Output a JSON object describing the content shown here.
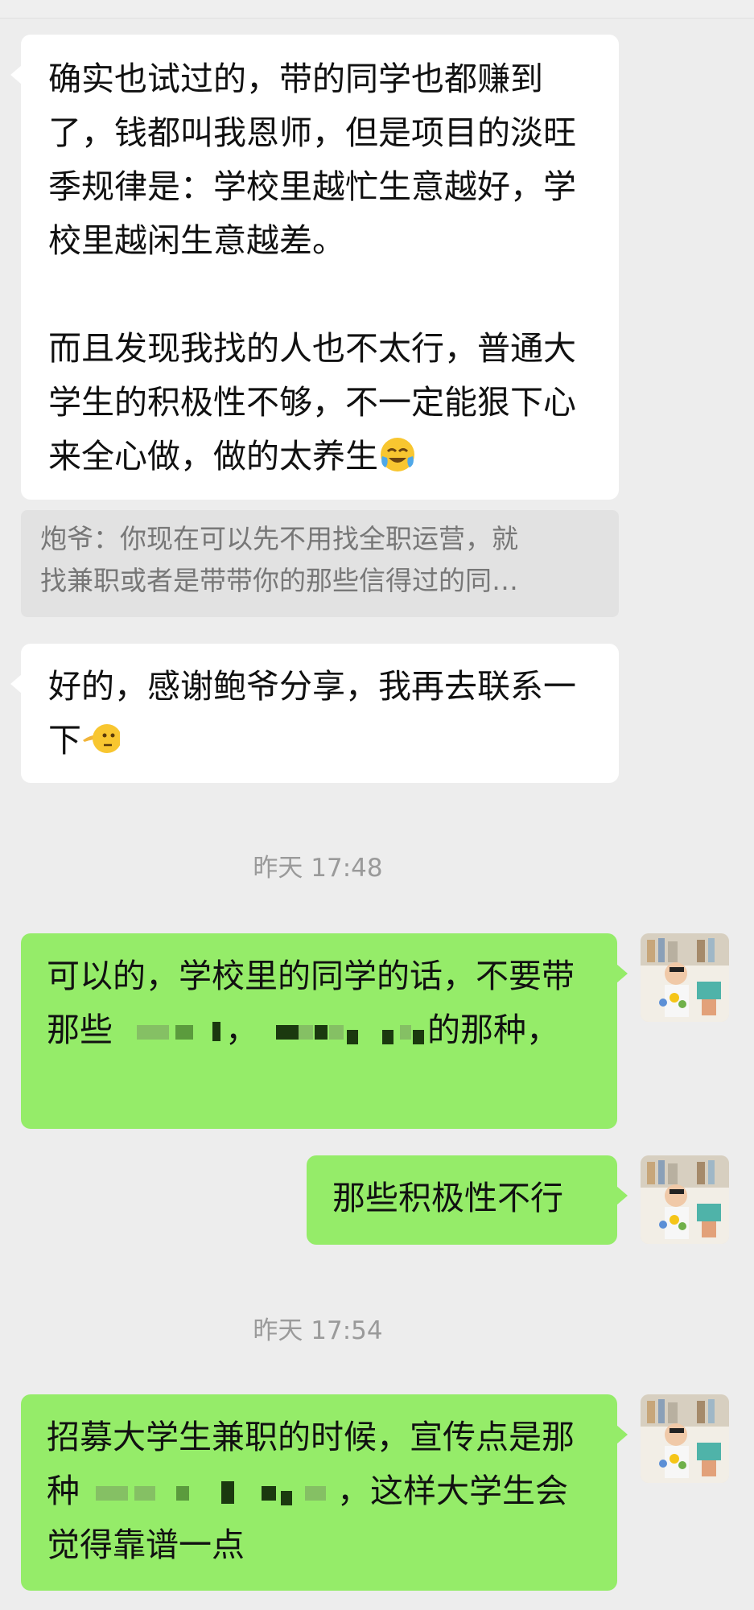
{
  "messages": [
    {
      "side": "left",
      "paragraph1": "确实也试过的，带的同学也都赚到了，钱都叫我恩师，但是项目的淡旺季规律是：学校里越忙生意越好，学校里越闲生意越差。",
      "paragraph2": "而且发现我找的人也不太行，普通大学生的积极性不够，不一定能狠下心来全心做，做的太养生",
      "emoji": "face-with-tears-of-joy-emoji"
    },
    {
      "quote_line1": "炮爷：你现在可以先不用找全职运营，就",
      "quote_line2": "找兼职或者是带带你的那些信得过的同…"
    },
    {
      "side": "left",
      "text": "好的，感谢鲍爷分享，我再去联系一下",
      "emoji": "pointing-face-emoji"
    },
    {
      "timestamp": "昨天 17:48"
    },
    {
      "side": "right",
      "part1": "可以的，学校里的同学的话，不要带那些",
      "part2": "，",
      "part3": "的那种，"
    },
    {
      "side": "right",
      "text": "那些积极性不行"
    },
    {
      "timestamp": "昨天 17:54"
    },
    {
      "side": "right",
      "part1": "招募大学生兼职的时候，宣传点是那种",
      "part2": "，这样大学生会觉得靠谱一点"
    }
  ],
  "colors": {
    "background": "#ededed",
    "left_bubble": "#ffffff",
    "right_bubble": "#95ec69",
    "quote_bg": "#e2e2e2",
    "timestamp_text": "#9a9a9a"
  }
}
